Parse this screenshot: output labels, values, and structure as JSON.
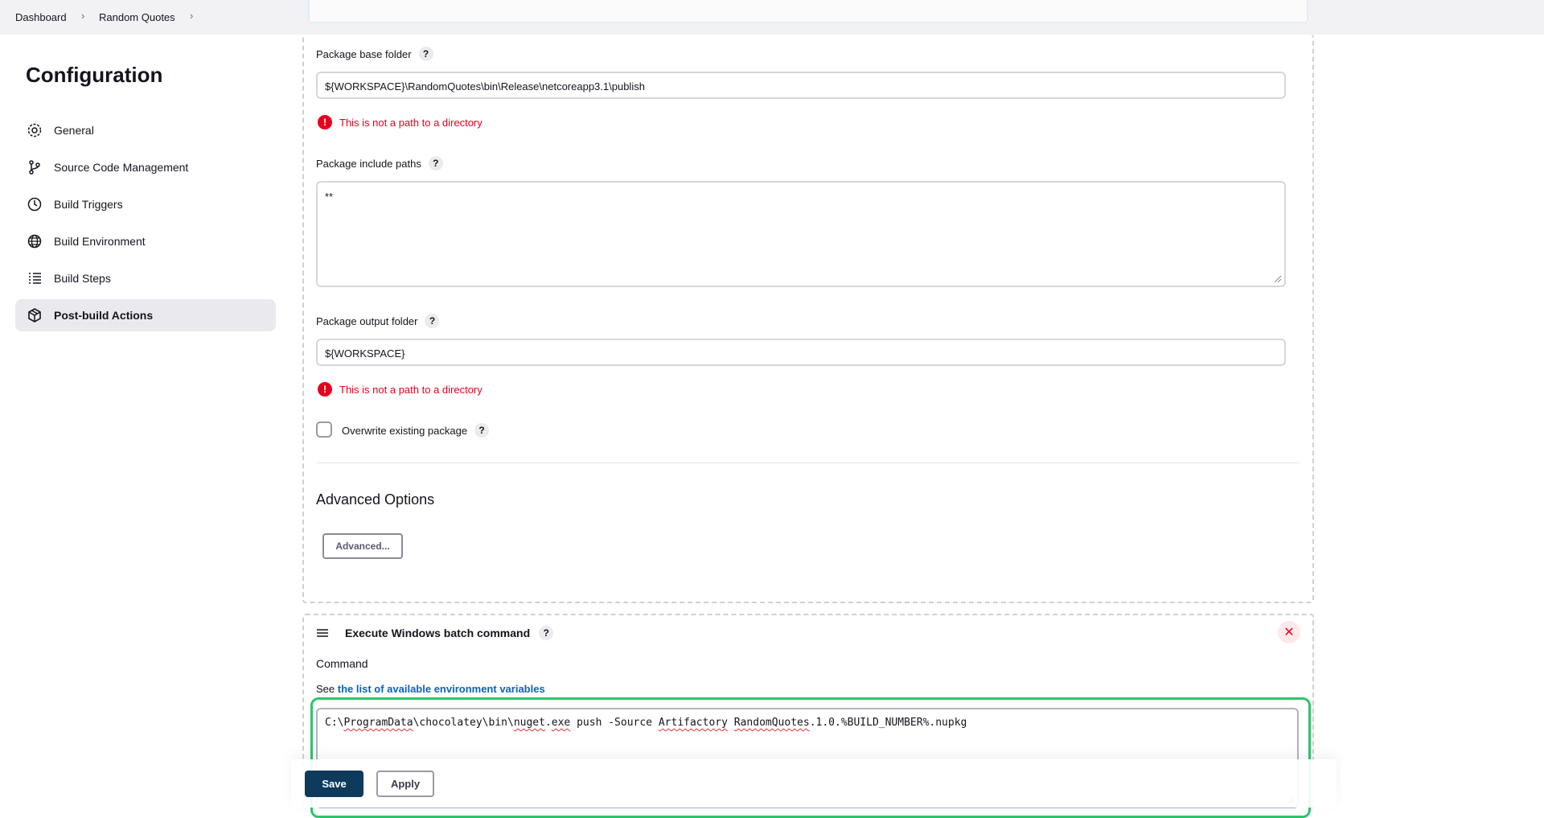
{
  "breadcrumb": {
    "items": [
      "Dashboard",
      "Random Quotes"
    ]
  },
  "sidebar": {
    "title": "Configuration",
    "items": [
      {
        "label": "General",
        "icon": "gear-icon"
      },
      {
        "label": "Source Code Management",
        "icon": "branch-icon"
      },
      {
        "label": "Build Triggers",
        "icon": "clock-icon"
      },
      {
        "label": "Build Environment",
        "icon": "globe-icon"
      },
      {
        "label": "Build Steps",
        "icon": "list-icon"
      },
      {
        "label": "Post-build Actions",
        "icon": "package-icon",
        "active": true
      }
    ]
  },
  "package_section": {
    "base_folder_label": "Package base folder",
    "base_folder_value": "${WORKSPACE}\\RandomQuotes\\bin\\Release\\netcoreapp3.1\\publish",
    "base_folder_error": "This is not a path to a directory",
    "include_paths_label": "Package include paths",
    "include_paths_value": "**",
    "output_folder_label": "Package output folder",
    "output_folder_value": "${WORKSPACE}",
    "output_folder_error": "This is not a path to a directory",
    "overwrite_label": "Overwrite existing package",
    "overwrite_checked": false,
    "advanced_title": "Advanced Options",
    "advanced_button": "Advanced..."
  },
  "batch_step": {
    "title": "Execute Windows batch command",
    "command_label": "Command",
    "see_prefix": "See",
    "see_link": "the list of available environment variables",
    "command_parts": [
      "C:\\",
      "ProgramData",
      "\\chocolatey\\bin\\",
      "nuget",
      ".",
      "exe",
      " push -Source ",
      "Artifactory",
      " ",
      "RandomQuotes",
      ".1.0.%BUILD_NUMBER%.nupkg"
    ]
  },
  "footer": {
    "save_label": "Save",
    "apply_label": "Apply"
  },
  "help_glyph": "?",
  "error_glyph": "!",
  "close_glyph": "✕",
  "colors": {
    "accent": "#0e3a5c",
    "error": "#e6001f",
    "highlight": "#2ec46a",
    "link": "#0b63b7"
  }
}
